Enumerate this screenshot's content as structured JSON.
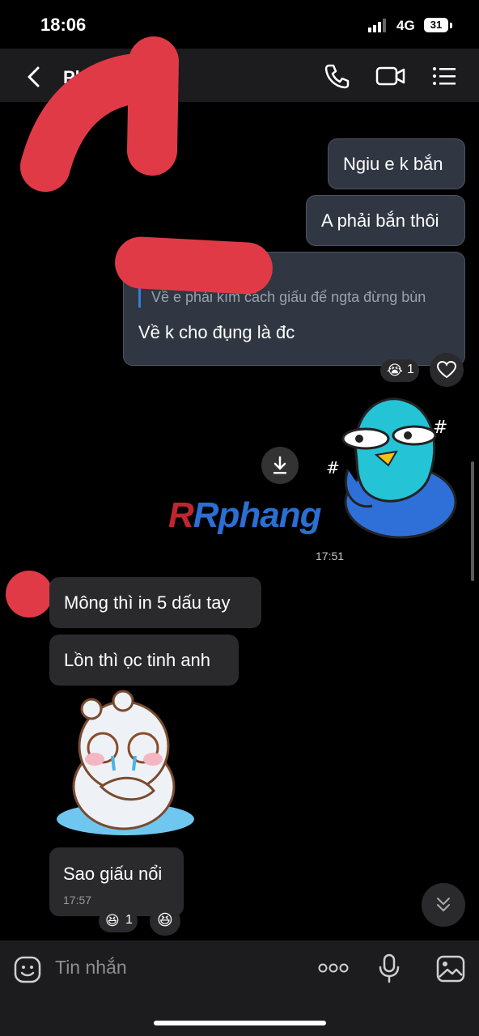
{
  "status_bar": {
    "time": "18:06",
    "network": "4G",
    "battery": "31"
  },
  "header": {
    "contact_name": "Ph...n"
  },
  "messages": {
    "m1": "Ngiu e k bắn",
    "m2": "A phải bắn thôi",
    "quote": "Về e phải kím cách giấu để ngta đừng bùn",
    "m3": "Về k cho đụng là đc",
    "m3_reaction_count": "1",
    "sticker_time": "17:51",
    "in1": "Mông thì in 5 dấu tay",
    "in2": "Lồn thì ọc tinh anh",
    "in3": "Sao giấu nổi",
    "in3_time": "17:57",
    "in3_reaction_count": "1"
  },
  "watermark": "Rphang",
  "input": {
    "placeholder": "Tin nhắn"
  },
  "colors": {
    "outgoing_bubble": "#303742",
    "incoming_bubble": "#2a2a2c",
    "quote_bar": "#3a7bd5",
    "redaction": "#e03a47"
  }
}
